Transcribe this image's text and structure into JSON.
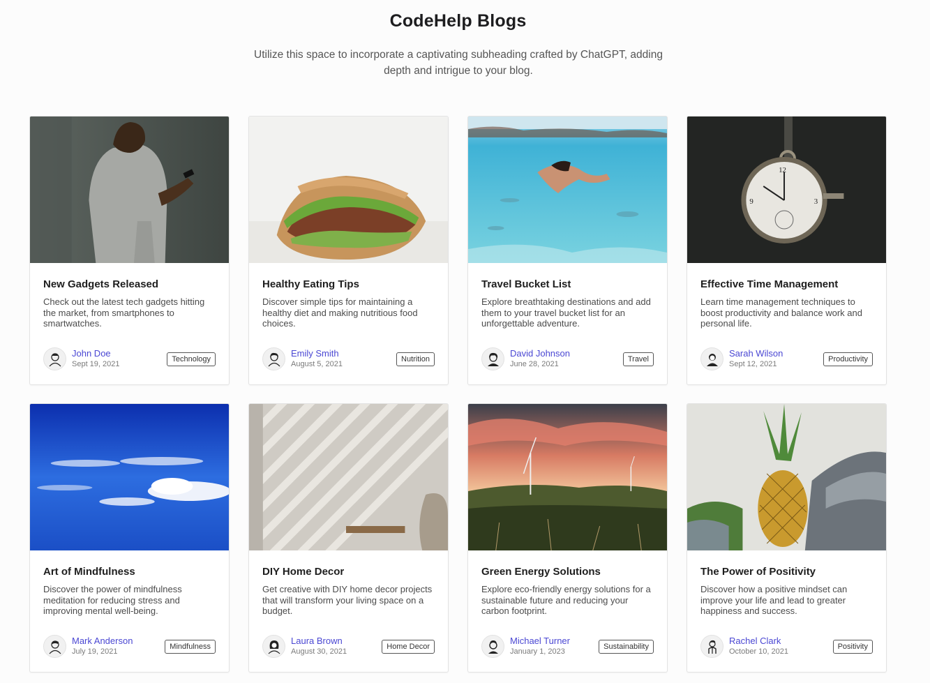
{
  "header": {
    "title": "CodeHelp Blogs",
    "subtitle": "Utilize this space to incorporate a captivating subheading crafted by ChatGPT, adding depth and intrigue to your blog."
  },
  "posts": [
    {
      "title": "New Gadgets Released",
      "description": "Check out the latest tech gadgets hitting the market, from smartphones to smartwatches.",
      "author": "John Doe",
      "date": "Sept 19, 2021",
      "tag": "Technology",
      "image": "man-with-phone"
    },
    {
      "title": "Healthy Eating Tips",
      "description": "Discover simple tips for maintaining a healthy diet and making nutritious food choices.",
      "author": "Emily Smith",
      "date": "August 5, 2021",
      "tag": "Nutrition",
      "image": "sandwich"
    },
    {
      "title": "Travel Bucket List",
      "description": "Explore breathtaking destinations and add them to your travel bucket list for an unforgettable adventure.",
      "author": "David Johnson",
      "date": "June 28, 2021",
      "tag": "Travel",
      "image": "underwater-swimmer"
    },
    {
      "title": "Effective Time Management",
      "description": "Learn time management techniques to boost productivity and balance work and personal life.",
      "author": "Sarah Wilson",
      "date": "Sept 12, 2021",
      "tag": "Productivity",
      "image": "pocket-watch"
    },
    {
      "title": "Art of Mindfulness",
      "description": "Discover the power of mindfulness meditation for reducing stress and improving mental well-being.",
      "author": "Mark Anderson",
      "date": "July 19, 2021",
      "tag": "Mindfulness",
      "image": "clouds-sky"
    },
    {
      "title": "DIY Home Decor",
      "description": "Get creative with DIY home decor projects that will transform your living space on a budget.",
      "author": "Laura Brown",
      "date": "August 30, 2021",
      "tag": "Home Decor",
      "image": "shadow-wall"
    },
    {
      "title": "Green Energy Solutions",
      "description": "Explore eco-friendly energy solutions for a sustainable future and reducing your carbon footprint.",
      "author": "Michael Turner",
      "date": "January 1, 2023",
      "tag": "Sustainability",
      "image": "wind-turbines"
    },
    {
      "title": "The Power of Positivity",
      "description": "Discover how a positive mindset can improve your life and lead to greater happiness and success.",
      "author": "Rachel Clark",
      "date": "October 10, 2021",
      "tag": "Positivity",
      "image": "pineapple"
    }
  ]
}
